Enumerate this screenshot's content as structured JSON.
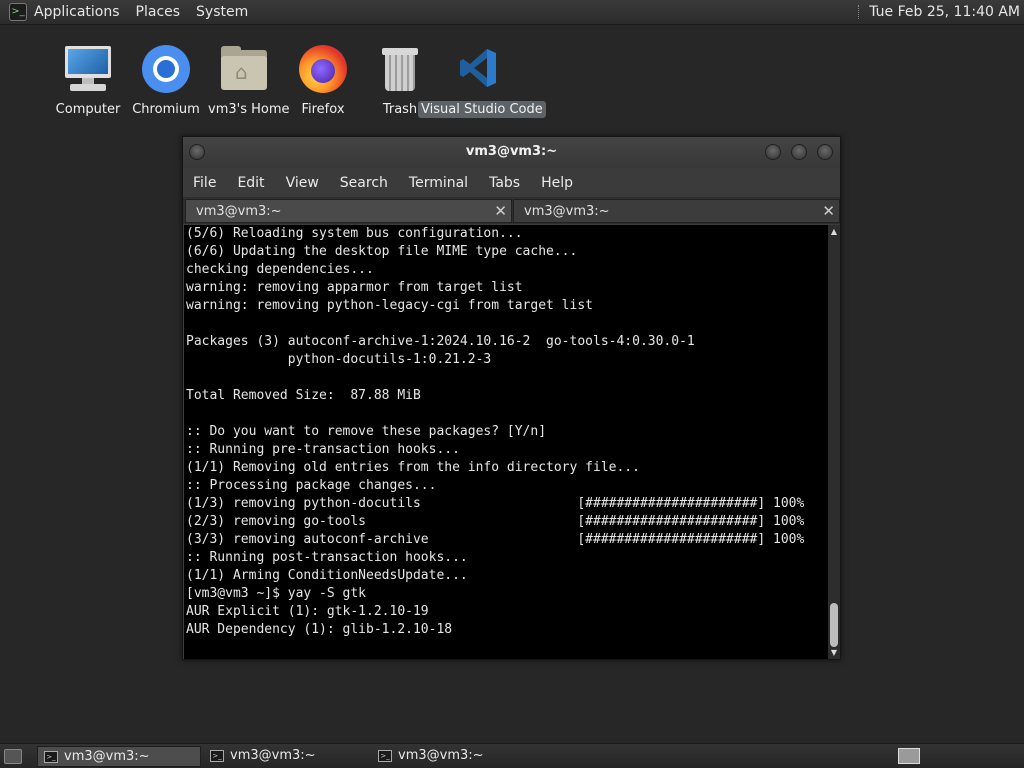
{
  "top_panel": {
    "menus": [
      "Applications",
      "Places",
      "System"
    ],
    "clock": "Tue Feb 25, 11:40 AM"
  },
  "desktop": {
    "icons": [
      {
        "label": "Computer",
        "icon": "computer-icon"
      },
      {
        "label": "Chromium",
        "icon": "chromium-icon"
      },
      {
        "label": "vm3's Home",
        "icon": "home-folder-icon"
      },
      {
        "label": "Firefox",
        "icon": "firefox-icon"
      },
      {
        "label": "Trash",
        "icon": "trash-icon"
      },
      {
        "label": "Visual Studio Code",
        "icon": "vscode-icon",
        "selected": true
      }
    ]
  },
  "window": {
    "title": "vm3@vm3:~",
    "menu": [
      "File",
      "Edit",
      "View",
      "Search",
      "Terminal",
      "Tabs",
      "Help"
    ],
    "tabs": [
      {
        "label": "vm3@vm3:~",
        "active": true
      },
      {
        "label": "vm3@vm3:~",
        "active": false
      }
    ],
    "lines": [
      "(5/6) Reloading system bus configuration...",
      "(6/6) Updating the desktop file MIME type cache...",
      "checking dependencies...",
      "warning: removing apparmor from target list",
      "warning: removing python-legacy-cgi from target list",
      "",
      "Packages (3) autoconf-archive-1:2024.10.16-2  go-tools-4:0.30.0-1",
      "             python-docutils-1:0.21.2-3",
      "",
      "Total Removed Size:  87.88 MiB",
      "",
      ":: Do you want to remove these packages? [Y/n]",
      ":: Running pre-transaction hooks...",
      "(1/1) Removing old entries from the info directory file...",
      ":: Processing package changes...",
      "(1/3) removing python-docutils                    [######################] 100%",
      "(2/3) removing go-tools                           [######################] 100%",
      "(3/3) removing autoconf-archive                   [######################] 100%",
      ":: Running post-transaction hooks...",
      "(1/1) Arming ConditionNeedsUpdate...",
      "[vm3@vm3 ~]$ yay -S gtk",
      "AUR Explicit (1): gtk-1.2.10-19",
      "AUR Dependency (1): glib-1.2.10-18"
    ]
  },
  "taskbar": {
    "tasks": [
      {
        "label": "vm3@vm3:~",
        "active": true
      },
      {
        "label": "vm3@vm3:~",
        "active": false
      },
      {
        "label": "vm3@vm3:~",
        "active": false
      }
    ]
  }
}
